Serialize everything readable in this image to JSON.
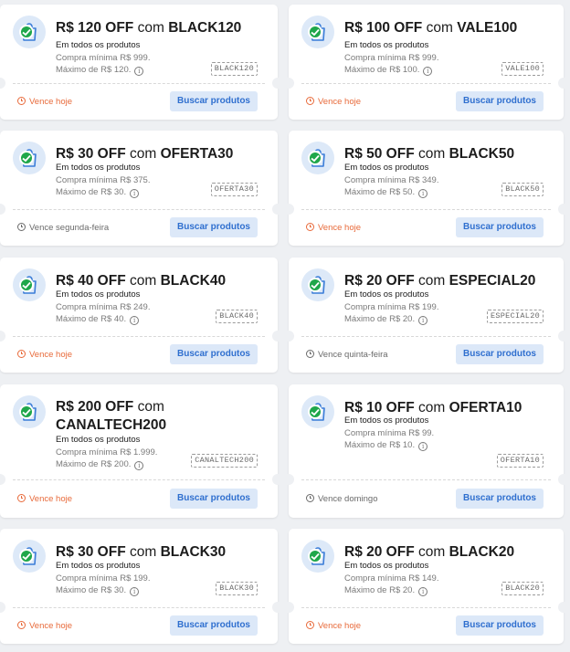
{
  "colors": {
    "accent": "#2f6fcf",
    "button_bg": "#dce8f8",
    "expires_today": "#e86a3a",
    "check_green": "#1fa74a",
    "background": "#eef0f3"
  },
  "coupons": [
    {
      "title_amount": "R$ 120 OFF",
      "title_connector": "com",
      "title_code": "BLACK120",
      "scope": "Em todos os produtos",
      "min_purchase": "Compra mínima R$ 999.",
      "max_discount": "Máximo de R$ 120.",
      "code": "BLACK120",
      "expires": "Vence hoje",
      "expires_today": true,
      "button": "Buscar produtos",
      "icon": "shopping-bag-icon"
    },
    {
      "title_amount": "R$ 100 OFF",
      "title_connector": "com",
      "title_code": "VALE100",
      "scope": "Em todos os produtos",
      "min_purchase": "Compra mínima R$ 999.",
      "max_discount": "Máximo de R$ 100.",
      "code": "VALE100",
      "expires": "Vence hoje",
      "expires_today": true,
      "button": "Buscar produtos",
      "icon": "shopping-bag-icon"
    },
    {
      "title_amount": "R$ 30 OFF",
      "title_connector": "com",
      "title_code": "OFERTA30",
      "scope": "Em todos os produtos",
      "min_purchase": "Compra mínima R$ 375.",
      "max_discount": "Máximo de R$ 30.",
      "code": "OFERTA30",
      "expires": "Vence segunda-feira",
      "expires_today": false,
      "button": "Buscar produtos",
      "icon": "shopping-bag-icon"
    },
    {
      "title_amount": "R$ 50 OFF",
      "title_connector": "com",
      "title_code": "BLACK50",
      "scope": "Em todos os produtos",
      "min_purchase": "Compra mínima R$ 349.",
      "max_discount": "Máximo de R$ 50.",
      "code": "BLACK50",
      "expires": "Vence hoje",
      "expires_today": true,
      "button": "Buscar produtos",
      "icon": "shopping-bag-icon"
    },
    {
      "title_amount": "R$ 40 OFF",
      "title_connector": "com",
      "title_code": "BLACK40",
      "scope": "Em todos os produtos",
      "min_purchase": "Compra mínima R$ 249.",
      "max_discount": "Máximo de R$ 40.",
      "code": "BLACK40",
      "expires": "Vence hoje",
      "expires_today": true,
      "button": "Buscar produtos",
      "icon": "shopping-bag-icon"
    },
    {
      "title_amount": "R$ 20 OFF",
      "title_connector": "com",
      "title_code": "ESPECIAL20",
      "scope": "Em todos os produtos",
      "min_purchase": "Compra mínima R$ 199.",
      "max_discount": "Máximo de R$ 20.",
      "code": "ESPECIAL20",
      "expires": "Vence quinta-feira",
      "expires_today": false,
      "button": "Buscar produtos",
      "icon": "shopping-bag-icon"
    },
    {
      "title_amount": "R$ 200 OFF",
      "title_connector": "com",
      "title_code": "CANALTECH200",
      "scope": "Em todos os produtos",
      "min_purchase": "Compra mínima R$ 1.999.",
      "max_discount": "Máximo de R$ 200.",
      "code": "CANALTECH200",
      "expires": "Vence hoje",
      "expires_today": true,
      "button": "Buscar produtos",
      "icon": "shopping-bag-icon"
    },
    {
      "title_amount": "R$ 10 OFF",
      "title_connector": "com",
      "title_code": "OFERTA10",
      "scope": "Em todos os produtos",
      "min_purchase": "Compra mínima R$ 99.",
      "max_discount": "Máximo de R$ 10.",
      "code": "OFERTA10",
      "expires": "Vence domingo",
      "expires_today": false,
      "button": "Buscar produtos",
      "icon": "shopping-bag-icon"
    },
    {
      "title_amount": "R$ 30 OFF",
      "title_connector": "com",
      "title_code": "BLACK30",
      "scope": "Em todos os produtos",
      "min_purchase": "Compra mínima R$ 199.",
      "max_discount": "Máximo de R$ 30.",
      "code": "BLACK30",
      "expires": "Vence hoje",
      "expires_today": true,
      "button": "Buscar produtos",
      "icon": "shopping-bag-icon"
    },
    {
      "title_amount": "R$ 20 OFF",
      "title_connector": "com",
      "title_code": "BLACK20",
      "scope": "Em todos os produtos",
      "min_purchase": "Compra mínima R$ 149.",
      "max_discount": "Máximo de R$ 20.",
      "code": "BLACK20",
      "expires": "Vence hoje",
      "expires_today": true,
      "button": "Buscar produtos",
      "icon": "shopping-bag-icon"
    }
  ]
}
